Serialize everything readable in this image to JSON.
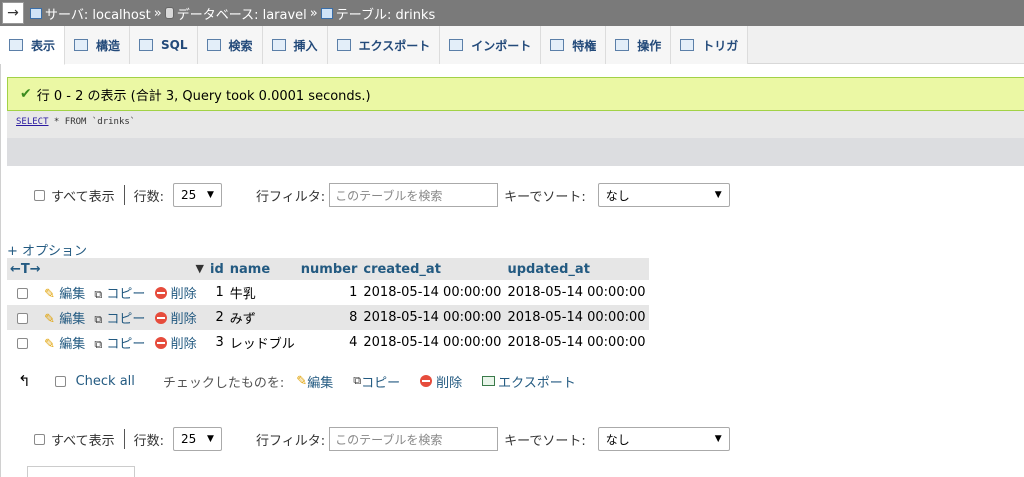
{
  "breadcrumb": {
    "arrow": "→",
    "items": [
      {
        "label": "サーバ: localhost"
      },
      {
        "label": "データベース: laravel"
      },
      {
        "label": "テーブル: drinks"
      }
    ],
    "separator": "»"
  },
  "tabs": [
    {
      "label": "表示",
      "active": true
    },
    {
      "label": "構造"
    },
    {
      "label": "SQL"
    },
    {
      "label": "検索"
    },
    {
      "label": "挿入"
    },
    {
      "label": "エクスポート"
    },
    {
      "label": "インポート"
    },
    {
      "label": "特権"
    },
    {
      "label": "操作"
    },
    {
      "label": "トリガ"
    }
  ],
  "message": {
    "text": "行 0 - 2 の表示 (合計 3, Query took 0.0001 seconds.)"
  },
  "sql": {
    "keyword": "SELECT",
    "rest": " * FROM `drinks`"
  },
  "nav": {
    "show_all": "すべて表示",
    "rows_label": "行数:",
    "rows_value": "25",
    "filter_label": "行フィルタ:",
    "filter_placeholder": "このテーブルを検索",
    "sort_label": "キーでソート:",
    "sort_value": "なし"
  },
  "options_link": "+ オプション",
  "table": {
    "arrows": "←T→",
    "columns": [
      "id",
      "name",
      "number",
      "created_at",
      "updated_at"
    ],
    "action_edit": "編集",
    "action_copy": "コピー",
    "action_delete": "削除",
    "rows": [
      {
        "id": "1",
        "name": "牛乳",
        "number": "1",
        "created_at": "2018-05-14 00:00:00",
        "updated_at": "2018-05-14 00:00:00"
      },
      {
        "id": "2",
        "name": "みず",
        "number": "8",
        "created_at": "2018-05-14 00:00:00",
        "updated_at": "2018-05-14 00:00:00"
      },
      {
        "id": "3",
        "name": "レッドブル",
        "number": "4",
        "created_at": "2018-05-14 00:00:00",
        "updated_at": "2018-05-14 00:00:00"
      }
    ]
  },
  "bulk": {
    "check_all": "Check all",
    "with_selected": "チェックしたものを:",
    "edit": "編集",
    "copy": "コピー",
    "delete": "削除",
    "export": "エクスポート"
  }
}
